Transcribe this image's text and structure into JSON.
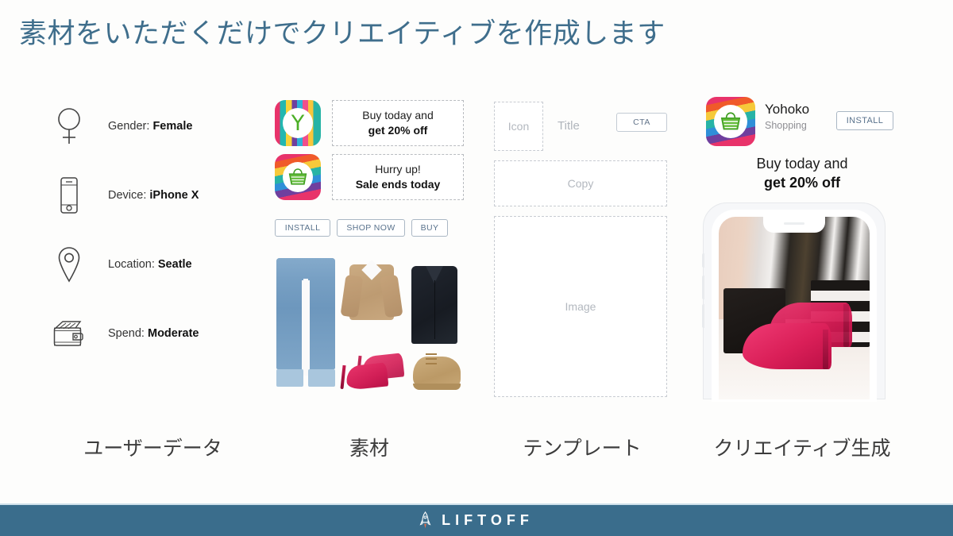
{
  "slide": {
    "title": "素材をいただくだけでクリエイティブを作成します",
    "title_color": "#3f6e8c",
    "background": "#fdfdfc"
  },
  "columns": [
    {
      "caption": "ユーザーデータ"
    },
    {
      "caption": "素材"
    },
    {
      "caption": "テンプレート"
    },
    {
      "caption": "クリエイティブ生成"
    }
  ],
  "user_data": {
    "rows": [
      {
        "icon": "gender-female-icon",
        "label": "Gender:",
        "value": "Female"
      },
      {
        "icon": "smartphone-icon",
        "label": "Device:",
        "value": "iPhone X"
      },
      {
        "icon": "location-pin-icon",
        "label": "Location:",
        "value": "Seatle"
      },
      {
        "icon": "wallet-icon",
        "label": "Spend:",
        "value": "Moderate"
      }
    ]
  },
  "assets": {
    "app_icons": [
      {
        "name": "yohoko-y-app-icon",
        "glyph": "Y"
      },
      {
        "name": "yohoko-basket-app-icon",
        "glyph": "basket"
      }
    ],
    "text_assets": [
      {
        "line1": "Buy today and",
        "line2": "get 20% off"
      },
      {
        "line1": "Hurry up!",
        "line2": "Sale ends today"
      }
    ],
    "cta_buttons": [
      "INSTALL",
      "SHOP NOW",
      "BUY"
    ],
    "product_collage": [
      "blue-jeans",
      "camel-sweater",
      "navy-coat",
      "pink-heels",
      "tan-boots"
    ]
  },
  "template": {
    "icon_placeholder": "Icon",
    "title_placeholder": "Title",
    "cta_placeholder": "CTA",
    "copy_placeholder": "Copy",
    "image_placeholder": "Image"
  },
  "creative": {
    "app_name": "Yohoko",
    "app_category": "Shopping",
    "install_label": "INSTALL",
    "copy_line1": "Buy today and",
    "copy_line2": "get 20% off",
    "preview_image": "pink-heels-in-store-on-iphone-x"
  },
  "footer": {
    "brand": "LIFTOFF",
    "icon": "rocket-icon",
    "background": "#3a6d8c"
  }
}
